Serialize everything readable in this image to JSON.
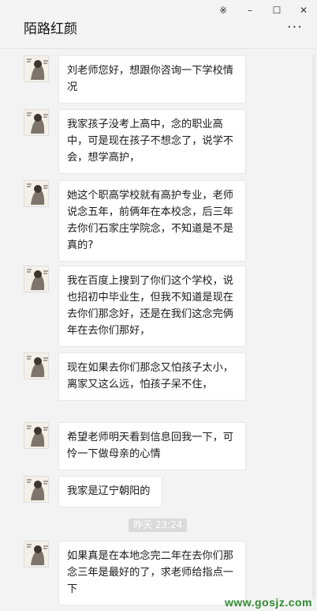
{
  "window": {
    "controls": {
      "pin": "※",
      "minimize": "–",
      "maximize": "☐",
      "close": "✕"
    }
  },
  "header": {
    "title": "陌路红颜",
    "more": "···"
  },
  "messages": [
    {
      "text": "刘老师您好，想跟你咨询一下学校情况"
    },
    {
      "text": "我家孩子没考上高中，念的职业高中，可是现在孩子不想念了，说学不会，想学高护，"
    },
    {
      "text": "她这个职高学校就有高护专业，老师说念五年，前俩年在本校念，后三年去你们石家庄学院念，不知道是不是真的?"
    },
    {
      "text": "我在百度上搜到了你们这个学校，说也招初中毕业生，但我不知道是现在去你们那念好，还是在我们这念完俩年在去你们那好，"
    },
    {
      "text": "现在如果去你们那念又怕孩子太小，离家又这么远，怕孩子呆不住，"
    },
    {
      "text": "希望老师明天看到信息回我一下，可怜一下做母亲的心情"
    },
    {
      "text": "我家是辽宁朝阳的"
    },
    {
      "text": "如果真是在本地念完二年在去你们那念三年是最好的了，求老师给指点一下"
    }
  ],
  "timestamp": "昨天 23:24",
  "watermark": "www.gosjz.com",
  "colors": {
    "background": "#f3f3f3",
    "bubble": "#ffffff",
    "timestamp_bg": "#dadada",
    "watermark": "#2e8b2e"
  }
}
